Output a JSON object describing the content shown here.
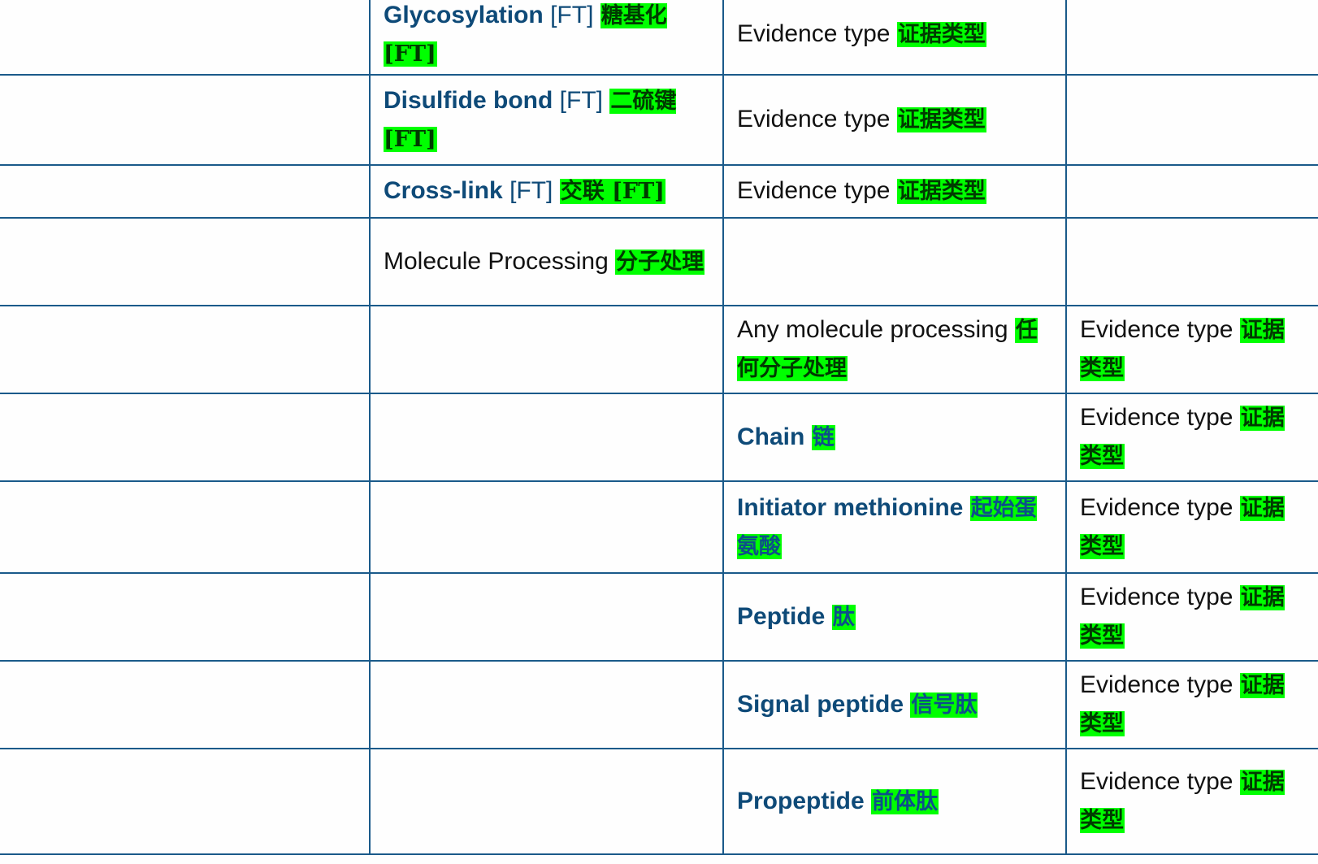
{
  "rows": [
    {
      "name": {
        "term": "Glycosylation",
        "suffix": "[FT]",
        "cn": "糖基化 [FT]"
      },
      "evidence_col": 2,
      "evidence": {
        "text": "Evidence type",
        "cn": "证据类型"
      }
    },
    {
      "name": {
        "term": "Disulfide bond",
        "suffix": "[FT]",
        "cn": "二硫键 [FT]"
      },
      "evidence_col": 2,
      "evidence": {
        "text": "Evidence type",
        "cn": "证据类型"
      }
    },
    {
      "name": {
        "term": "Cross-link",
        "suffix": "[FT]",
        "cn": "交联 [FT]"
      },
      "evidence_col": 2,
      "evidence": {
        "text": "Evidence type",
        "cn": "证据类型"
      }
    },
    {
      "name": {
        "text": "Molecule Processing",
        "cn": "分子处理"
      }
    },
    {
      "sub": {
        "text": "Any molecule processing",
        "cn": "任何分子处理"
      },
      "evidence": {
        "text": "Evidence type",
        "cn": "证据类型"
      }
    },
    {
      "sub": {
        "term": "Chain",
        "cn": "链"
      },
      "evidence": {
        "text": "Evidence type",
        "cn": "证据类型"
      }
    },
    {
      "sub": {
        "term": "Initiator methionine",
        "cn": "起始蛋氨酸"
      },
      "evidence": {
        "text": "Evidence type",
        "cn": "证据类型"
      }
    },
    {
      "sub": {
        "term": "Peptide",
        "cn": "肽"
      },
      "evidence": {
        "text": "Evidence type",
        "cn": "证据类型"
      }
    },
    {
      "sub": {
        "term": "Signal peptide",
        "cn": "信号肽"
      },
      "evidence": {
        "text": "Evidence type",
        "cn": "证据类型"
      }
    },
    {
      "sub": {
        "term": "Propeptide",
        "cn": "前体肽"
      },
      "evidence": {
        "text": "Evidence type",
        "cn": "证据类型"
      }
    }
  ]
}
